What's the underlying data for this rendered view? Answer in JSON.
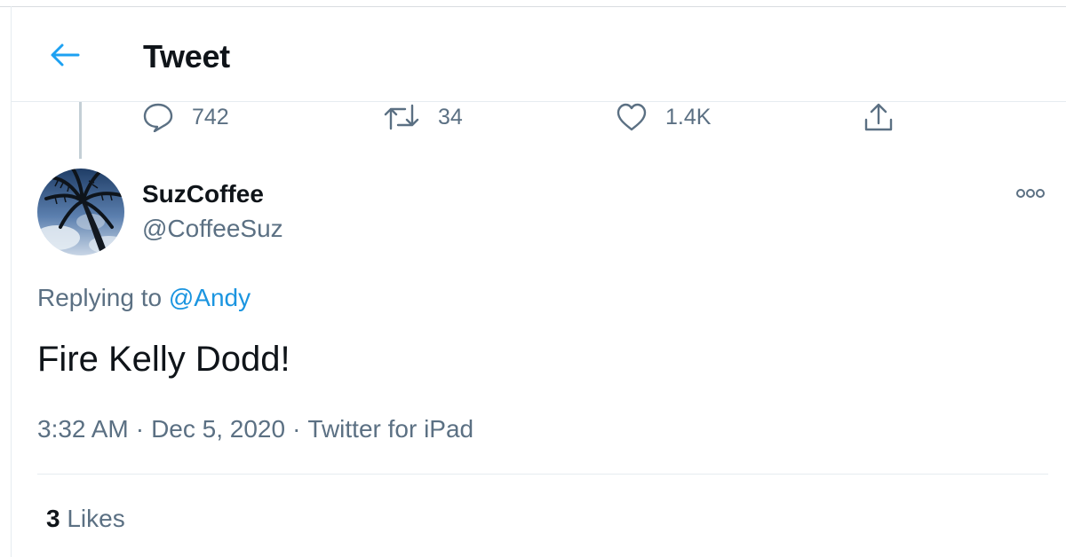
{
  "header": {
    "title": "Tweet",
    "back_icon": "arrow-left-icon",
    "accent_color": "#1da1f2"
  },
  "parent_actions": {
    "reply": {
      "icon": "comment-icon",
      "count": "742"
    },
    "retweet": {
      "icon": "retweet-icon",
      "count": "34"
    },
    "like": {
      "icon": "heart-icon",
      "count": "1.4K"
    },
    "share": {
      "icon": "share-icon"
    }
  },
  "tweet": {
    "user": {
      "display_name": "SuzCoffee",
      "handle": "@CoffeeSuz",
      "avatar": "palm-tree-avatar"
    },
    "more_icon": "more-options-icon",
    "replying_to_prefix": "Replying to",
    "replying_to_handle": "@Andy",
    "text": "Fire Kelly Dodd!",
    "time": "3:32 AM",
    "separator": "·",
    "date": "Dec 5, 2020",
    "source": "Twitter for iPad",
    "likes_count": "3",
    "likes_label": "Likes"
  },
  "colors": {
    "link": "#1b95e0",
    "secondary_text": "#5b7083",
    "primary_text": "#0f1419",
    "border": "#e6ecf0"
  }
}
